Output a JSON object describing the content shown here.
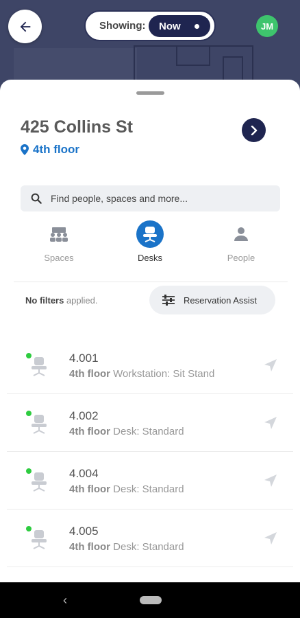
{
  "header": {
    "showing_label": "Showing:",
    "showing_value": "Now",
    "avatar_initials": "JM"
  },
  "location": {
    "title": "425 Collins St",
    "floor": "4th floor"
  },
  "search": {
    "placeholder": "Find people, spaces and more..."
  },
  "tabs": [
    {
      "label": "Spaces",
      "icon": "meeting-room-icon",
      "active": false
    },
    {
      "label": "Desks",
      "icon": "chair-icon",
      "active": true
    },
    {
      "label": "People",
      "icon": "person-icon",
      "active": false
    }
  ],
  "filters": {
    "bold": "No filters",
    "rest": " applied.",
    "assist_label": "Reservation Assist"
  },
  "desks": [
    {
      "name": "4.001",
      "floor": "4th floor",
      "type": "Workstation: Sit Stand",
      "status": "available"
    },
    {
      "name": "4.002",
      "floor": "4th floor",
      "type": "Desk: Standard",
      "status": "available"
    },
    {
      "name": "4.004",
      "floor": "4th floor",
      "type": "Desk: Standard",
      "status": "available"
    },
    {
      "name": "4.005",
      "floor": "4th floor",
      "type": "Desk: Standard",
      "status": "available"
    }
  ],
  "colors": {
    "accent": "#1a73c8",
    "navy": "#1f2550",
    "available": "#2ecc40",
    "avatar": "#3ec46d"
  }
}
